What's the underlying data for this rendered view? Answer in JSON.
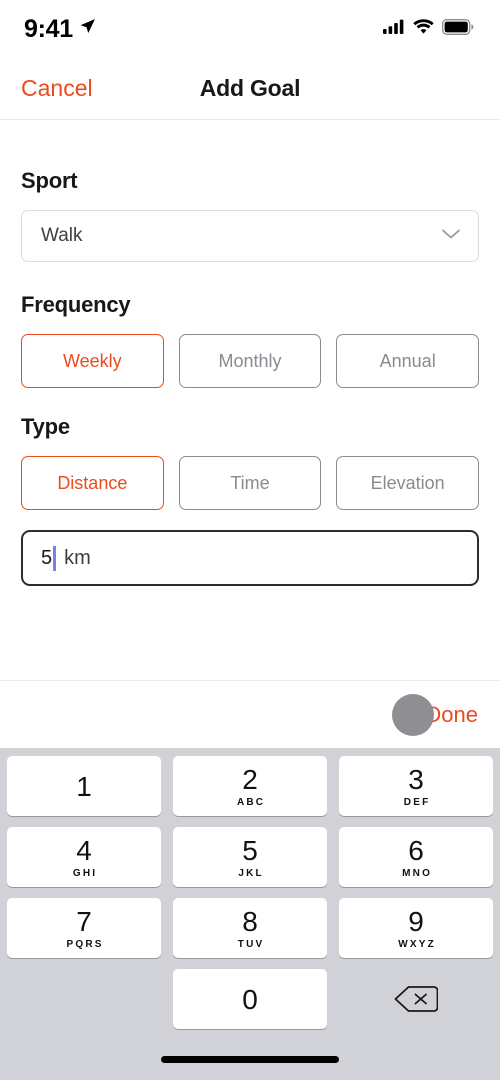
{
  "status_bar": {
    "time": "9:41",
    "location_icon": "location-arrow-icon",
    "signal_icon": "cellular-signal-icon",
    "wifi_icon": "wifi-icon",
    "battery_icon": "battery-full-icon"
  },
  "nav": {
    "cancel_label": "Cancel",
    "title": "Add Goal"
  },
  "form": {
    "sport": {
      "label": "Sport",
      "value": "Walk",
      "chevron_icon": "chevron-down-icon"
    },
    "frequency": {
      "label": "Frequency",
      "options": [
        {
          "label": "Weekly",
          "selected": true
        },
        {
          "label": "Monthly",
          "selected": false
        },
        {
          "label": "Annual",
          "selected": false
        }
      ]
    },
    "type": {
      "label": "Type",
      "options": [
        {
          "label": "Distance",
          "selected": true
        },
        {
          "label": "Time",
          "selected": false
        },
        {
          "label": "Elevation",
          "selected": false
        }
      ]
    },
    "amount": {
      "value": "5",
      "unit": "km"
    }
  },
  "accessory": {
    "done_label": "Done"
  },
  "keyboard": {
    "keys": [
      {
        "digit": "1",
        "letters": ""
      },
      {
        "digit": "2",
        "letters": "ABC"
      },
      {
        "digit": "3",
        "letters": "DEF"
      },
      {
        "digit": "4",
        "letters": "GHI"
      },
      {
        "digit": "5",
        "letters": "JKL"
      },
      {
        "digit": "6",
        "letters": "MNO"
      },
      {
        "digit": "7",
        "letters": "PQRS"
      },
      {
        "digit": "8",
        "letters": "TUV"
      },
      {
        "digit": "9",
        "letters": "WXYZ"
      },
      {
        "digit": "0",
        "letters": ""
      }
    ],
    "delete_icon": "delete-backspace-icon"
  },
  "colors": {
    "accent": "#ec4a1f",
    "text": "#18181b",
    "muted": "#8a8a90",
    "keyboard_bg": "#d1d1d8",
    "caret": "#7b7fe8"
  }
}
